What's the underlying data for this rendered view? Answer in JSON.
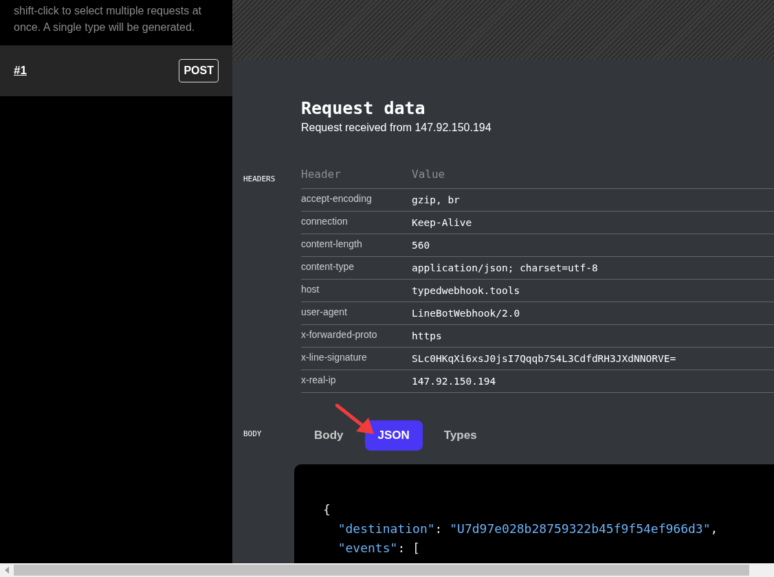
{
  "sidebar": {
    "hint": "shift-click to select multiple requests at once. A single type will be generated.",
    "requests": [
      {
        "label": "#1",
        "method": "POST",
        "selected": true
      }
    ]
  },
  "request": {
    "title": "Request data",
    "subtitle": "Request received from 147.92.150.194",
    "headers_label": "HEADERS",
    "columns": [
      "Header",
      "Value"
    ],
    "rows": [
      {
        "name": "accept-encoding",
        "value": "gzip, br"
      },
      {
        "name": "connection",
        "value": "Keep-Alive"
      },
      {
        "name": "content-length",
        "value": "560"
      },
      {
        "name": "content-type",
        "value": "application/json; charset=utf-8"
      },
      {
        "name": "host",
        "value": "typedwebhook.tools"
      },
      {
        "name": "user-agent",
        "value": "LineBotWebhook/2.0"
      },
      {
        "name": "x-forwarded-proto",
        "value": "https"
      },
      {
        "name": "x-line-signature",
        "value": "SLc0HKqXi6xsJ0jsI7Qqqb7S4L3CdfdRH3JXdNNORVE="
      },
      {
        "name": "x-real-ip",
        "value": "147.92.150.194"
      }
    ],
    "body_label": "BODY",
    "tabs": [
      {
        "label": "Body",
        "selected": false
      },
      {
        "label": "JSON",
        "selected": true
      },
      {
        "label": "Types",
        "selected": false
      }
    ],
    "code": [
      [
        {
          "kind": "punct",
          "text": "{"
        }
      ],
      [
        {
          "kind": "key",
          "text": "  \"destination\""
        },
        {
          "kind": "punct",
          "text": ": "
        },
        {
          "kind": "string",
          "text": "\"U7d97e028b28759322b45f9f54ef966d3\""
        },
        {
          "kind": "punct",
          "text": ","
        }
      ],
      [
        {
          "kind": "key",
          "text": "  \"events\""
        },
        {
          "kind": "punct",
          "text": ": ["
        }
      ]
    ]
  }
}
